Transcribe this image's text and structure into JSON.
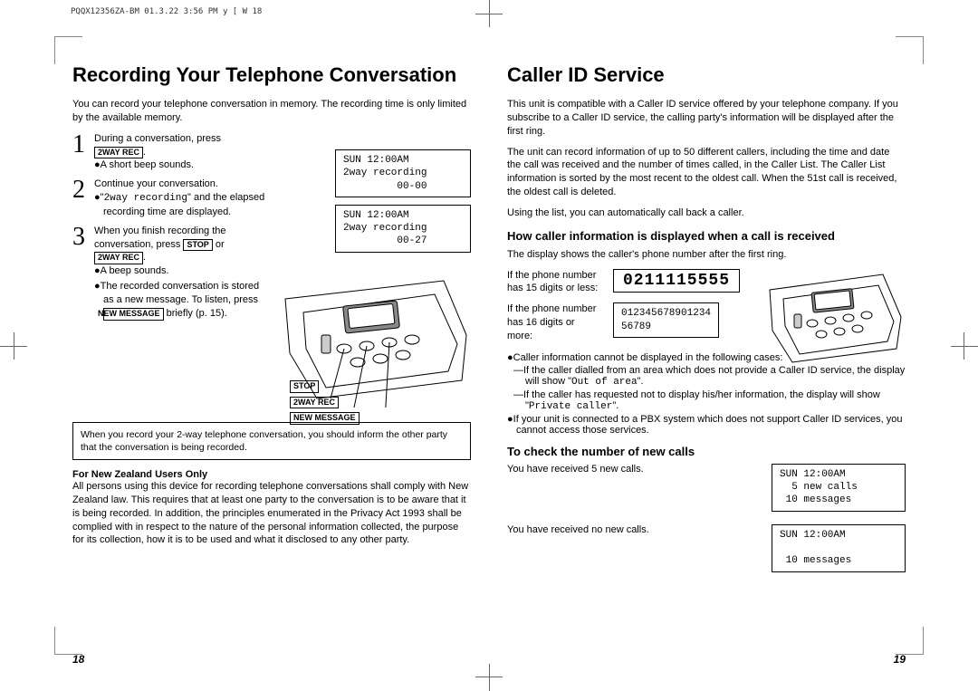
{
  "header_code": "PQQX12356ZA-BM 01.3.22 3:56 PM y [ W 18",
  "left": {
    "title": "Recording Your Telephone Conversation",
    "intro": "You can record your telephone conversation in memory. The recording time is only limited by the available memory.",
    "step1_a": "During a conversation, press",
    "btn_2way": "2WAY REC",
    "step1_b": "A short beep sounds.",
    "step2_a": "Continue your conversation.",
    "step2_b_pre": "\"",
    "step2_b_mono": "2way recording",
    "step2_b_post": "\" and the elapsed recording time are displayed.",
    "step3_a": "When you finish recording the conversation, press ",
    "btn_stop": "STOP",
    "step3_or": " or ",
    "step3_bullets": [
      "A beep sounds.",
      "The recorded conversation is stored as a new message. To listen, press "
    ],
    "btn_newmsg": "NEW MESSAGE",
    "briefly": " briefly (p. 15).",
    "lcd1": "SUN 12:00AM\n2way recording\n         00-00",
    "lcd2": "SUN 12:00AM\n2way recording\n         00-27",
    "callout_stop": "STOP",
    "callout_2way": "2WAY REC",
    "callout_newmsg": "NEW MESSAGE",
    "note": "When you record your 2-way telephone conversation, you should inform the other party that the conversation is being recorded.",
    "nz_title": "For New Zealand Users Only",
    "nz_body": "All persons using this device for recording telephone conversations shall comply with New Zealand law. This requires that at least one party to the conversation is to be aware that it is being recorded. In addition, the principles enumerated in the Privacy Act 1993 shall be complied with in respect to the nature of the personal information collected, the purpose for its collection, how it is to be used and what it disclosed to any other party.",
    "pagenum": "18"
  },
  "right": {
    "title": "Caller ID Service",
    "intro1": "This unit is compatible with a Caller ID service offered by your telephone company. If you subscribe to a Caller ID service, the calling party's information will be displayed after the first ring.",
    "intro2": "The unit can record information of up to 50 different callers, including the time and date the call was received and the number of times called, in the Caller List. The Caller List information is sorted by the most recent to the oldest call. When the 51st call is received, the oldest call is deleted.",
    "intro3": "Using the list, you can automatically call back a caller.",
    "sub1": "How caller information is displayed when a call is received",
    "sub1_text": "The display shows the caller's phone number after the first ring.",
    "row1_label": "If the phone number has 15 digits or less:",
    "row1_lcd": "0211115555",
    "row2_label": "If the phone number has 16 digits or more:",
    "row2_lcd": "012345678901234\n56789",
    "case_intro": "Caller information cannot be displayed in the following cases:",
    "case1_a": "—If the caller dialled from an area which does not provide a Caller ID service, the display will show \"",
    "case1_mono": "Out of area",
    "case1_b": "\".",
    "case2_a": "—If the caller has requested not to display his/her information, the display will show \"",
    "case2_mono": "Private caller",
    "case2_b": "\".",
    "pbx_note": "If your unit is connected to a PBX system which does not support Caller ID services, you cannot access those services.",
    "sub2": "To check the number of new calls",
    "check1_text": "You have received 5 new calls.",
    "check1_lcd": "SUN 12:00AM\n  5 new calls\n 10 messages",
    "check2_text": "You have received no new calls.",
    "check2_lcd": "SUN 12:00AM\n\n 10 messages",
    "pagenum": "19"
  }
}
